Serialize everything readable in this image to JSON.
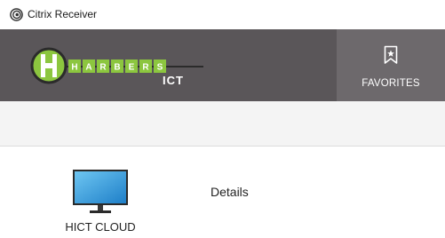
{
  "window": {
    "title": "Citrix Receiver",
    "icon": "citrix-receiver-icon"
  },
  "header": {
    "logo": {
      "letters": [
        "H",
        "A",
        "R",
        "B",
        "E",
        "R",
        "S"
      ],
      "subtext": "ICT",
      "accent_color": "#8cc63f"
    },
    "favorites": {
      "label": "FAVORITES",
      "icon": "bookmark-star-icon"
    },
    "background_color": "#5a5659"
  },
  "apps": [
    {
      "name": "HICT CLOUD",
      "icon": "desktop-monitor-icon"
    }
  ],
  "details": {
    "label": "Details"
  }
}
